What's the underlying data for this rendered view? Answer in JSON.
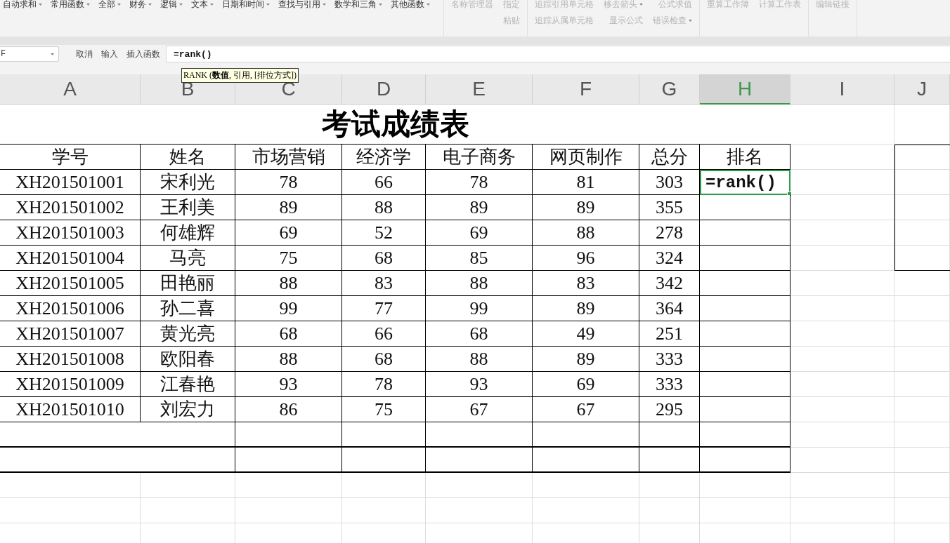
{
  "ribbon": {
    "function_menus": [
      {
        "label": "自动求和",
        "dropdown": true
      },
      {
        "label": "常用函数",
        "dropdown": true
      },
      {
        "label": "全部",
        "dropdown": true
      },
      {
        "label": "财务",
        "dropdown": true
      },
      {
        "label": "逻辑",
        "dropdown": true
      },
      {
        "label": "文本",
        "dropdown": true
      },
      {
        "label": "日期和时间",
        "dropdown": true
      },
      {
        "label": "查找与引用",
        "dropdown": true
      },
      {
        "label": "数学和三角",
        "dropdown": true
      },
      {
        "label": "其他函数",
        "dropdown": true
      }
    ],
    "groups": [
      {
        "columns": [
          [
            {
              "label": "名称管理器",
              "dropdown": false,
              "disabled": true
            }
          ],
          [
            {
              "label": "指定",
              "dropdown": false,
              "disabled": true
            },
            {
              "label": "粘贴",
              "dropdown": false,
              "disabled": true
            }
          ]
        ]
      },
      {
        "columns": [
          [
            {
              "label": "追踪引用单元格",
              "dropdown": false,
              "disabled": true
            },
            {
              "label": "追踪从属单元格",
              "dropdown": false,
              "disabled": true
            }
          ],
          [
            {
              "label": "移去箭头",
              "dropdown": true,
              "disabled": true
            },
            {
              "label": "显示公式",
              "dropdown": false,
              "disabled": true
            }
          ],
          [
            {
              "label": "公式求值",
              "dropdown": false,
              "disabled": true
            },
            {
              "label": "错误检查",
              "dropdown": true,
              "disabled": true
            }
          ]
        ]
      },
      {
        "columns": [
          [
            {
              "label": "重算工作簿",
              "dropdown": false,
              "disabled": true
            }
          ],
          [
            {
              "label": "计算工作表",
              "dropdown": false,
              "disabled": true
            }
          ]
        ]
      },
      {
        "columns": [
          [
            {
              "label": "编辑链接",
              "dropdown": false,
              "disabled": true
            }
          ]
        ]
      }
    ]
  },
  "formula_bar": {
    "name_box": "F",
    "buttons": [
      "取消",
      "输入",
      "插入函数"
    ],
    "formula": "=rank()",
    "tooltip": "RANK (**数值**, 引用, [排位方式])"
  },
  "sheet": {
    "columns": [
      {
        "label": "A",
        "selected": false
      },
      {
        "label": "B",
        "selected": false
      },
      {
        "label": "C",
        "selected": false
      },
      {
        "label": "D",
        "selected": false
      },
      {
        "label": "E",
        "selected": false
      },
      {
        "label": "F",
        "selected": false
      },
      {
        "label": "G",
        "selected": false
      },
      {
        "label": "H",
        "selected": true
      },
      {
        "label": "I",
        "selected": false
      },
      {
        "label": "J",
        "selected": false
      }
    ],
    "title": "考试成绩表",
    "headers": [
      "学号",
      "姓名",
      "市场营销",
      "经济学",
      "电子商务",
      "网页制作",
      "总分",
      "排名"
    ],
    "rows": [
      {
        "cells": [
          {
            "text": "XH201501001",
            "selected": false
          },
          {
            "text": "宋利光",
            "selected": false
          },
          {
            "text": "78",
            "selected": false
          },
          {
            "text": "66",
            "selected": false
          },
          {
            "text": "78",
            "selected": false
          },
          {
            "text": "81",
            "selected": false
          },
          {
            "text": "303",
            "selected": false
          },
          {
            "text": "=rank()",
            "selected": true
          }
        ]
      },
      {
        "cells": [
          {
            "text": "XH201501002",
            "selected": false
          },
          {
            "text": "王利美",
            "selected": false
          },
          {
            "text": "89",
            "selected": false
          },
          {
            "text": "88",
            "selected": false
          },
          {
            "text": "89",
            "selected": false
          },
          {
            "text": "89",
            "selected": false
          },
          {
            "text": "355",
            "selected": false
          },
          {
            "selected": false
          }
        ]
      },
      {
        "cells": [
          {
            "text": "XH201501003",
            "selected": false
          },
          {
            "text": "何雄辉",
            "selected": false
          },
          {
            "text": "69",
            "selected": false
          },
          {
            "text": "52",
            "selected": false
          },
          {
            "text": "69",
            "selected": false
          },
          {
            "text": "88",
            "selected": false
          },
          {
            "text": "278",
            "selected": false
          },
          {
            "selected": false
          }
        ]
      },
      {
        "cells": [
          {
            "text": "XH201501004",
            "selected": false
          },
          {
            "text": "马亮",
            "selected": false
          },
          {
            "text": "75",
            "selected": false
          },
          {
            "text": "68",
            "selected": false
          },
          {
            "text": "85",
            "selected": false
          },
          {
            "text": "96",
            "selected": false
          },
          {
            "text": "324",
            "selected": false
          },
          {
            "selected": false
          }
        ]
      },
      {
        "cells": [
          {
            "text": "XH201501005",
            "selected": false
          },
          {
            "text": "田艳丽",
            "selected": false
          },
          {
            "text": "88",
            "selected": false
          },
          {
            "text": "83",
            "selected": false
          },
          {
            "text": "88",
            "selected": false
          },
          {
            "text": "83",
            "selected": false
          },
          {
            "text": "342",
            "selected": false
          },
          {
            "selected": false
          }
        ]
      },
      {
        "cells": [
          {
            "text": "XH201501006",
            "selected": false
          },
          {
            "text": "孙二喜",
            "selected": false
          },
          {
            "text": "99",
            "selected": false
          },
          {
            "text": "77",
            "selected": false
          },
          {
            "text": "99",
            "selected": false
          },
          {
            "text": "89",
            "selected": false
          },
          {
            "text": "364",
            "selected": false
          },
          {
            "selected": false
          }
        ]
      },
      {
        "cells": [
          {
            "text": "XH201501007",
            "selected": false
          },
          {
            "text": "黄光亮",
            "selected": false
          },
          {
            "text": "68",
            "selected": false
          },
          {
            "text": "66",
            "selected": false
          },
          {
            "text": "68",
            "selected": false
          },
          {
            "text": "49",
            "selected": false
          },
          {
            "text": "251",
            "selected": false
          },
          {
            "selected": false
          }
        ]
      },
      {
        "cells": [
          {
            "text": "XH201501008",
            "selected": false
          },
          {
            "text": "欧阳春",
            "selected": false
          },
          {
            "text": "88",
            "selected": false
          },
          {
            "text": "68",
            "selected": false
          },
          {
            "text": "88",
            "selected": false
          },
          {
            "text": "89",
            "selected": false
          },
          {
            "text": "333",
            "selected": false
          },
          {
            "selected": false
          }
        ]
      },
      {
        "cells": [
          {
            "text": "XH201501009",
            "selected": false
          },
          {
            "text": "江春艳",
            "selected": false
          },
          {
            "text": "93",
            "selected": false
          },
          {
            "text": "78",
            "selected": false
          },
          {
            "text": "93",
            "selected": false
          },
          {
            "text": "69",
            "selected": false
          },
          {
            "text": "333",
            "selected": false
          },
          {
            "selected": false
          }
        ]
      },
      {
        "cells": [
          {
            "text": "XH201501010",
            "selected": false
          },
          {
            "text": "刘宏力",
            "selected": false
          },
          {
            "text": "86",
            "selected": false
          },
          {
            "text": "75",
            "selected": false
          },
          {
            "text": "67",
            "selected": false
          },
          {
            "text": "67",
            "selected": false
          },
          {
            "text": "295",
            "selected": false
          },
          {
            "selected": false
          }
        ]
      }
    ]
  }
}
